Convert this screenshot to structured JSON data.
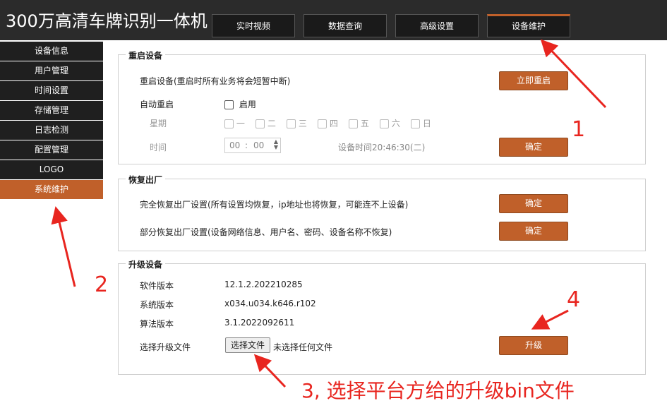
{
  "header": {
    "title": "300万高清车牌识别一体机",
    "tabs": [
      {
        "label": "实时视频"
      },
      {
        "label": "数据查询"
      },
      {
        "label": "高级设置"
      },
      {
        "label": "设备维护",
        "active": true
      }
    ]
  },
  "sidebar": {
    "items": [
      {
        "label": "设备信息"
      },
      {
        "label": "用户管理"
      },
      {
        "label": "时间设置"
      },
      {
        "label": "存储管理"
      },
      {
        "label": "日志检测"
      },
      {
        "label": "配置管理"
      },
      {
        "label": "LOGO"
      },
      {
        "label": "系统维护",
        "active": true
      }
    ]
  },
  "reboot": {
    "legend": "重启设备",
    "desc": "重启设备(重启时所有业务将会短暂中断)",
    "reboot_button": "立即重启",
    "auto_label": "自动重启",
    "enable_label": "启用",
    "week_label": "星期",
    "days": [
      "一",
      "二",
      "三",
      "四",
      "五",
      "六",
      "日"
    ],
    "time_label": "时间",
    "hour": "00",
    "minute": "00",
    "separator": ":",
    "device_time": "设备时间20:46:30(二)",
    "confirm_button": "确定"
  },
  "factory": {
    "legend": "恢复出厂",
    "full_desc": "完全恢复出厂设置(所有设置均恢复，ip地址也将恢复，可能连不上设备)",
    "full_button": "确定",
    "partial_desc": "部分恢复出厂设置(设备网络信息、用户名、密码、设备名称不恢复)",
    "partial_button": "确定"
  },
  "upgrade": {
    "legend": "升级设备",
    "software_label": "软件版本",
    "software_value": "12.1.2.202210285",
    "system_label": "系统版本",
    "system_value": "x034.u034.k646.r102",
    "algo_label": "算法版本",
    "algo_value": "3.1.2022092611",
    "file_label": "选择升级文件",
    "file_button": "选择文件",
    "file_status": "未选择任何文件",
    "upgrade_button": "升级"
  },
  "annotations": {
    "n1": "1",
    "n2": "2",
    "n3": "3, 选择平台方给的升级bin文件",
    "n4": "4",
    "color": "#e8251f"
  },
  "colors": {
    "accent": "#c0602a",
    "header_bg": "#2b2b2b",
    "sidebar_bg": "#1f1f1f"
  }
}
